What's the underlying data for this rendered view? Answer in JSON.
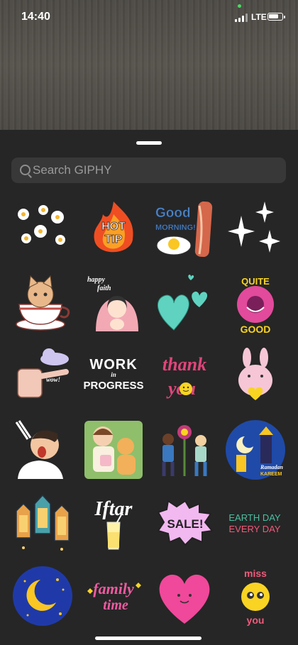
{
  "status_bar": {
    "time": "14:40",
    "network": "LTE",
    "battery_level": 0.75
  },
  "search": {
    "placeholder": "Search GIPHY",
    "value": ""
  },
  "stickers": [
    {
      "name": "daisies-sticker"
    },
    {
      "name": "hot-tip-sticker",
      "text": [
        "HOT",
        "TIP"
      ]
    },
    {
      "name": "good-morning-sticker",
      "text": [
        "Good",
        "MORNING!"
      ]
    },
    {
      "name": "sparkles-sticker"
    },
    {
      "name": "cat-in-cup-sticker"
    },
    {
      "name": "happy-faith-sticker",
      "text": [
        "happy",
        "faith"
      ]
    },
    {
      "name": "hearts-sticker"
    },
    {
      "name": "quite-good-sticker",
      "text": [
        "QUITE",
        "GOOD"
      ]
    },
    {
      "name": "pot-wow-sticker",
      "text": [
        "wow!"
      ]
    },
    {
      "name": "work-in-progress-sticker",
      "text": [
        "WORK",
        "in",
        "PROGRESS"
      ]
    },
    {
      "name": "thank-you-sticker",
      "text": [
        "thank",
        "you"
      ]
    },
    {
      "name": "bunny-heart-sticker"
    },
    {
      "name": "tired-man-sticker"
    },
    {
      "name": "friends-cats-sticker"
    },
    {
      "name": "people-flower-sticker"
    },
    {
      "name": "ramadan-kareem-sticker",
      "text": [
        "Ramadan",
        "KAREEM"
      ]
    },
    {
      "name": "lanterns-sticker"
    },
    {
      "name": "iftar-sticker",
      "text": [
        "Iftar"
      ]
    },
    {
      "name": "sale-sticker",
      "text": [
        "SALE!"
      ]
    },
    {
      "name": "earth-day-sticker",
      "text": [
        "EARTH DAY",
        "EVERY DAY"
      ]
    },
    {
      "name": "moon-stars-sticker"
    },
    {
      "name": "family-time-sticker",
      "text": [
        "family",
        "time"
      ]
    },
    {
      "name": "pink-heart-sticker"
    },
    {
      "name": "miss-you-sticker",
      "text": [
        "miss",
        "you"
      ]
    }
  ],
  "colors": {
    "sheet_bg": "#262626",
    "search_bg": "#383838",
    "placeholder": "#9a9a9a"
  }
}
